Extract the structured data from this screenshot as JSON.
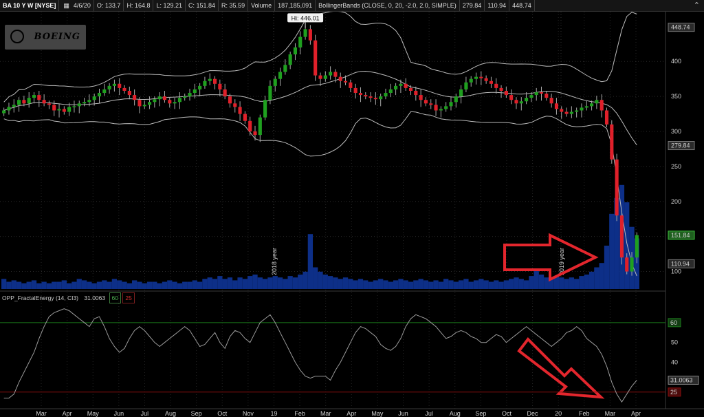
{
  "header": {
    "symbol": "BA 10 Y W [NYSE]",
    "date_icon": "calendar-icon",
    "date": "4/6/20",
    "open": "O: 133.7",
    "high": "H: 164.8",
    "low": "L: 129.21",
    "close": "C: 151.84",
    "range": "R: 35.59",
    "volume_label": "Volume",
    "volume_value": "187,185,091",
    "study": "BollingerBands (CLOSE, 0, 20, -2.0, 2.0, SIMPLE)",
    "bb_lower": "279.84",
    "bb_mid": "110.94",
    "bb_upper": "448.74"
  },
  "logo_text": "BOEING",
  "indicator_header": {
    "name": "OPP_FractalEnergy (14, CI3)",
    "value": "31.0063",
    "upper": "60",
    "lower": "25"
  },
  "colors": {
    "up": "#1fa01f",
    "down": "#e0202a",
    "volume": "#0d2f88",
    "band": "#bdbdbd",
    "arrow": "#e3262d",
    "level60": "#1b7a1b",
    "level25": "#8a0e0e"
  },
  "chart_data": [
    {
      "type": "candlestick",
      "title": "BA 10 Y W [NYSE]",
      "ylim": [
        75,
        470
      ],
      "yticks": [
        100,
        150,
        200,
        250,
        300,
        350,
        400
      ],
      "price_labels": [
        {
          "value": 448.74,
          "text": "448.74",
          "style": "band"
        },
        {
          "value": 279.84,
          "text": "279.84",
          "style": "band"
        },
        {
          "value": 151.84,
          "text": "151.84",
          "style": "price"
        },
        {
          "value": 110.94,
          "text": "110.94",
          "style": "band"
        }
      ],
      "annotation": {
        "text": "Hi: 446.01",
        "value": 446.01
      },
      "year_markers": [
        "2018 year",
        "2019 year"
      ],
      "x_labels": [
        "Mar",
        "Apr",
        "May",
        "Jun",
        "Jul",
        "Aug",
        "Sep",
        "Oct",
        "Nov",
        "19",
        "Feb",
        "Mar",
        "Apr",
        "May",
        "Jun",
        "Jul",
        "Aug",
        "Sep",
        "Oct",
        "Dec",
        "20",
        "Feb",
        "Mar",
        "Apr"
      ],
      "closes": [
        330,
        335,
        338,
        345,
        340,
        348,
        352,
        345,
        340,
        338,
        330,
        332,
        328,
        335,
        336,
        340,
        342,
        345,
        350,
        355,
        360,
        365,
        368,
        362,
        358,
        352,
        345,
        336,
        338,
        342,
        346,
        350,
        345,
        340,
        342,
        348,
        350,
        355,
        360,
        365,
        372,
        375,
        368,
        360,
        350,
        340,
        335,
        325,
        315,
        300,
        295,
        320,
        345,
        365,
        375,
        385,
        395,
        410,
        420,
        435,
        446,
        430,
        380,
        375,
        380,
        385,
        378,
        372,
        370,
        362,
        355,
        352,
        350,
        348,
        346,
        350,
        355,
        360,
        365,
        368,
        362,
        358,
        352,
        345,
        340,
        338,
        330,
        332,
        336,
        342,
        350,
        360,
        370,
        375,
        378,
        376,
        372,
        368,
        362,
        358,
        352,
        345,
        340,
        343,
        348,
        352,
        356,
        354,
        348,
        340,
        332,
        328,
        325,
        328,
        330,
        334,
        336,
        340,
        345,
        330,
        310,
        260,
        180,
        120,
        100,
        120,
        151.84
      ],
      "volume_relative": [
        0.07,
        0.05,
        0.06,
        0.05,
        0.04,
        0.05,
        0.06,
        0.04,
        0.05,
        0.04,
        0.05,
        0.05,
        0.06,
        0.04,
        0.05,
        0.07,
        0.06,
        0.05,
        0.04,
        0.05,
        0.06,
        0.05,
        0.07,
        0.06,
        0.05,
        0.04,
        0.06,
        0.05,
        0.04,
        0.05,
        0.05,
        0.04,
        0.05,
        0.06,
        0.05,
        0.04,
        0.05,
        0.05,
        0.06,
        0.05,
        0.07,
        0.08,
        0.07,
        0.09,
        0.07,
        0.08,
        0.06,
        0.08,
        0.07,
        0.09,
        0.1,
        0.08,
        0.07,
        0.08,
        0.09,
        0.08,
        0.07,
        0.09,
        0.08,
        0.1,
        0.12,
        0.38,
        0.15,
        0.12,
        0.1,
        0.09,
        0.08,
        0.07,
        0.08,
        0.07,
        0.06,
        0.07,
        0.06,
        0.05,
        0.06,
        0.07,
        0.06,
        0.05,
        0.06,
        0.07,
        0.06,
        0.05,
        0.06,
        0.07,
        0.06,
        0.05,
        0.06,
        0.05,
        0.07,
        0.06,
        0.05,
        0.06,
        0.07,
        0.05,
        0.06,
        0.07,
        0.06,
        0.05,
        0.06,
        0.05,
        0.06,
        0.07,
        0.08,
        0.07,
        0.06,
        0.09,
        0.14,
        0.1,
        0.08,
        0.07,
        0.09,
        0.08,
        0.07,
        0.08,
        0.07,
        0.09,
        0.1,
        0.12,
        0.15,
        0.18,
        0.3,
        0.52,
        0.63,
        0.72,
        0.6,
        0.43,
        0.35
      ]
    },
    {
      "type": "line",
      "title": "OPP_FractalEnergy (14, CI3)",
      "ylim": [
        18,
        70
      ],
      "yticks": [
        30,
        40,
        50,
        60
      ],
      "levels": [
        {
          "value": 60,
          "text": "60"
        },
        {
          "value": 25,
          "text": "25"
        }
      ],
      "last_value_label": "31.0063",
      "values": [
        22,
        22,
        24,
        30,
        35,
        40,
        45,
        52,
        58,
        63,
        65,
        66,
        67,
        66,
        64,
        62,
        60,
        58,
        62,
        63,
        58,
        52,
        48,
        45,
        47,
        52,
        56,
        58,
        56,
        53,
        50,
        48,
        50,
        52,
        54,
        56,
        58,
        56,
        52,
        48,
        49,
        52,
        55,
        50,
        47,
        53,
        56,
        55,
        52,
        50,
        55,
        60,
        62,
        64,
        60,
        55,
        50,
        45,
        40,
        36,
        33,
        32,
        33,
        33,
        33,
        31,
        36,
        40,
        45,
        50,
        55,
        58,
        57,
        55,
        53,
        49,
        47,
        46,
        48,
        52,
        58,
        62,
        64,
        63,
        62,
        60,
        58,
        55,
        52,
        53,
        55,
        56,
        55,
        53,
        52,
        50,
        50,
        52,
        54,
        53,
        50,
        52,
        54,
        56,
        58,
        56,
        54,
        52,
        50,
        48,
        50,
        52,
        55,
        56,
        58,
        56,
        52,
        50,
        48,
        44,
        38,
        30,
        24,
        20,
        24,
        28,
        31.0063
      ]
    }
  ]
}
